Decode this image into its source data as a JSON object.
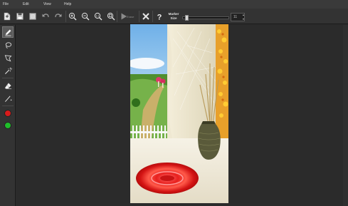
{
  "menu": {
    "file": "File",
    "edit": "Edit",
    "view": "View",
    "help": "Help"
  },
  "toolbar": {
    "erase_label": "Erase",
    "marker_size_line1": "Marker",
    "marker_size_line2": "Size",
    "marker_size_value": "11",
    "marker_size_fraction": 0.05,
    "icons": [
      "new-file-icon",
      "save-icon",
      "save-as-icon",
      "undo-icon",
      "redo-icon",
      "zoom-in-icon",
      "zoom-out-icon",
      "zoom-reset-icon",
      "zoom-fit-icon",
      "play-icon",
      "close-icon",
      "help-icon"
    ]
  },
  "tools": {
    "icons": [
      "marker-icon",
      "lasso-icon",
      "polygon-lasso-icon",
      "magic-wand-icon",
      "eraser-icon",
      "line-icon"
    ],
    "colors": {
      "primary": "#d81b1b",
      "secondary": "#1fbd2a"
    }
  }
}
